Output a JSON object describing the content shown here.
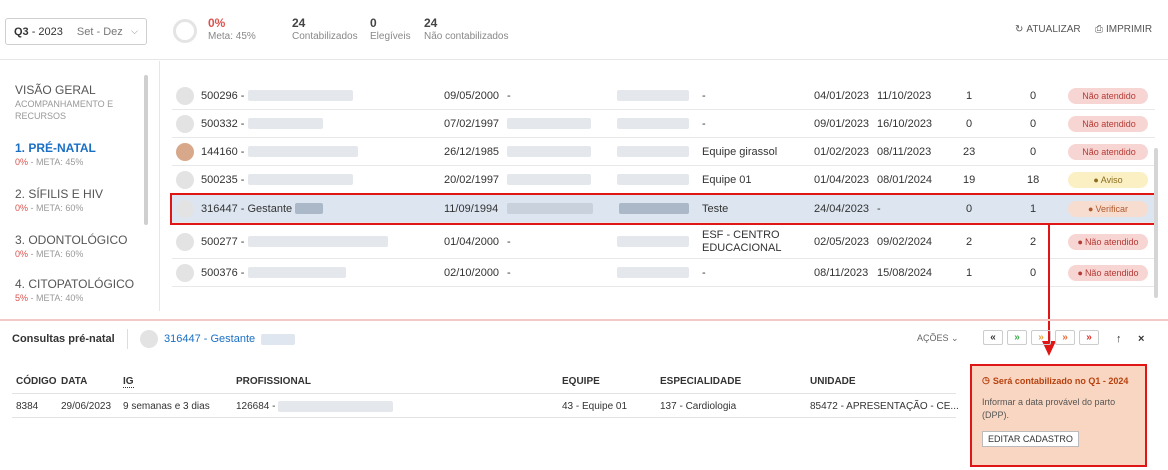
{
  "period": {
    "quarter": "Q3",
    "year": "2023",
    "months": "Set - Dez"
  },
  "summary": {
    "progress": "0%",
    "goal": "Meta: 45%",
    "stats": [
      {
        "value": "24",
        "label": "Contabilizados"
      },
      {
        "value": "0",
        "label": "Elegíveis"
      },
      {
        "value": "24",
        "label": "Não contabilizados"
      }
    ]
  },
  "toolbar": {
    "refresh_label": "ATUALIZAR",
    "print_label": "IMPRIMIR"
  },
  "sidebar": {
    "items": [
      {
        "title": "VISÃO GERAL",
        "subtitle": "ACOMPANHAMENTO E RECURSOS",
        "pct": "",
        "meta": ""
      },
      {
        "title": "1. PRÉ-NATAL",
        "subtitle": "",
        "pct": "0%",
        "meta": " - META: 45%"
      },
      {
        "title": "2. SÍFILIS E HIV",
        "subtitle": "",
        "pct": "0%",
        "meta": " - META: 60%"
      },
      {
        "title": "3. ODONTOLÓGICO",
        "subtitle": "",
        "pct": "0%",
        "meta": " - META: 60%"
      },
      {
        "title": "4. CITOPATOLÓGICO",
        "subtitle": "",
        "pct": "5%",
        "meta": " - META: 40%"
      }
    ]
  },
  "table": {
    "rows": [
      {
        "id": "500296 -",
        "birth": "09/05/2000",
        "c3": "-",
        "team": "-",
        "d1": "04/01/2023",
        "d2": "11/10/2023",
        "n1": "1",
        "n2": "0",
        "status": "Não atendido",
        "status_icon": ""
      },
      {
        "id": "500332 -",
        "birth": "07/02/1997",
        "c3": "",
        "team": "-",
        "d1": "09/01/2023",
        "d2": "16/10/2023",
        "n1": "0",
        "n2": "0",
        "status": "Não atendido",
        "status_icon": ""
      },
      {
        "id": "144160 -",
        "birth": "26/12/1985",
        "c3": "",
        "team": "Equipe girassol",
        "d1": "01/02/2023",
        "d2": "08/11/2023",
        "n1": "23",
        "n2": "0",
        "status": "Não atendido",
        "status_icon": ""
      },
      {
        "id": "500235 -",
        "birth": "20/02/1997",
        "c3": "",
        "team": "Equipe 01",
        "d1": "01/04/2023",
        "d2": "08/01/2024",
        "n1": "19",
        "n2": "18",
        "status": "Aviso",
        "status_icon": "●"
      },
      {
        "id": "316447 - Gestante",
        "birth": "11/09/1994",
        "c3": "",
        "team": "Teste",
        "d1": "24/04/2023",
        "d2": "-",
        "n1": "0",
        "n2": "1",
        "status": "Verificar",
        "status_icon": "●"
      },
      {
        "id": "500277 -",
        "birth": "01/04/2000",
        "c3": "-",
        "team": "ESF - CENTRO EDUCACIONAL",
        "d1": "02/05/2023",
        "d2": "09/02/2024",
        "n1": "2",
        "n2": "2",
        "status": "Não atendido",
        "status_icon": "●"
      },
      {
        "id": "500376 -",
        "birth": "02/10/2000",
        "c3": "-",
        "team": "-",
        "d1": "08/11/2023",
        "d2": "15/08/2024",
        "n1": "1",
        "n2": "0",
        "status": "Não atendido",
        "status_icon": "●"
      }
    ]
  },
  "bottom": {
    "title": "Consultas pré-natal",
    "patient": "316447 - Gestante",
    "actions_label": "AÇÕES",
    "headers": [
      "CÓDIGO",
      "DATA",
      "IG",
      "PROFISSIONAL",
      "EQUIPE",
      "ESPECIALIDADE",
      "UNIDADE"
    ],
    "row": [
      "8384",
      "29/06/2023",
      "9 semanas e 3 dias",
      "126684 -",
      "43 - Equipe 01",
      "137 - Cardiologia",
      "85472 - APRESENTAÇÃO - CE..."
    ]
  },
  "callout": {
    "heading": "Será contabilizado no Q1 - 2024",
    "body": "Informar a data provável do parto (DPP).",
    "button": "EDITAR CADASTRO"
  },
  "colors": {
    "accent": "#1a6fc4",
    "danger": "#d9534f",
    "highlight": "#e01515"
  }
}
